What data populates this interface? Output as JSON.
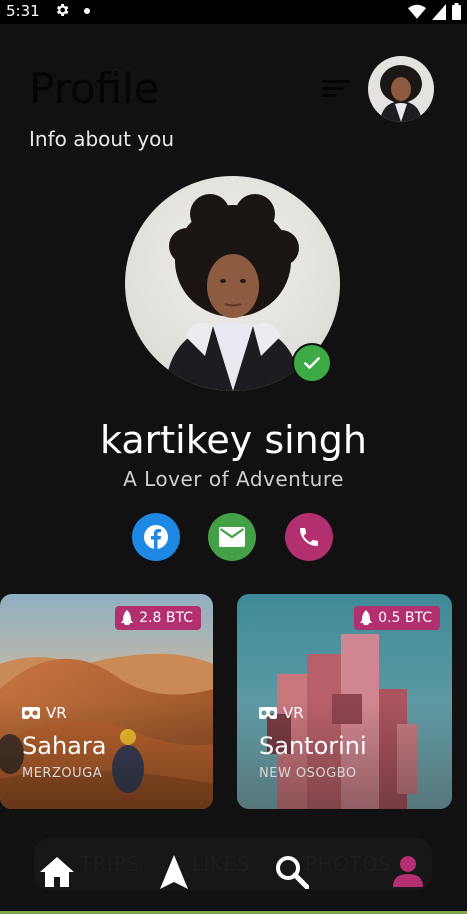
{
  "status_bar": {
    "time": "5:31"
  },
  "header": {
    "title": "Profile",
    "subtitle": "Info about you"
  },
  "profile": {
    "name": "kartikey singh",
    "tagline": "A Lover of Adventure"
  },
  "social": [
    "facebook-icon",
    "mail-icon",
    "phone-icon"
  ],
  "cards": [
    {
      "price": "2.8 BTC",
      "badge": "VR",
      "place": "Sahara",
      "region": "MERZOUGA"
    },
    {
      "price": "0.5 BTC",
      "badge": "VR",
      "place": "Santorini",
      "region": "NEW OSOGBO"
    }
  ],
  "tabs": {
    "trips": "TRIPS",
    "likes": "LIKES",
    "photos": "PHOTOS"
  },
  "nav": [
    "home-icon",
    "navigation-icon",
    "search-icon",
    "person-icon"
  ],
  "colors": {
    "accent": "#b2306f",
    "facebook": "#1e88e5",
    "mail": "#43a047",
    "verified": "#3cab45",
    "background": "#111112"
  }
}
